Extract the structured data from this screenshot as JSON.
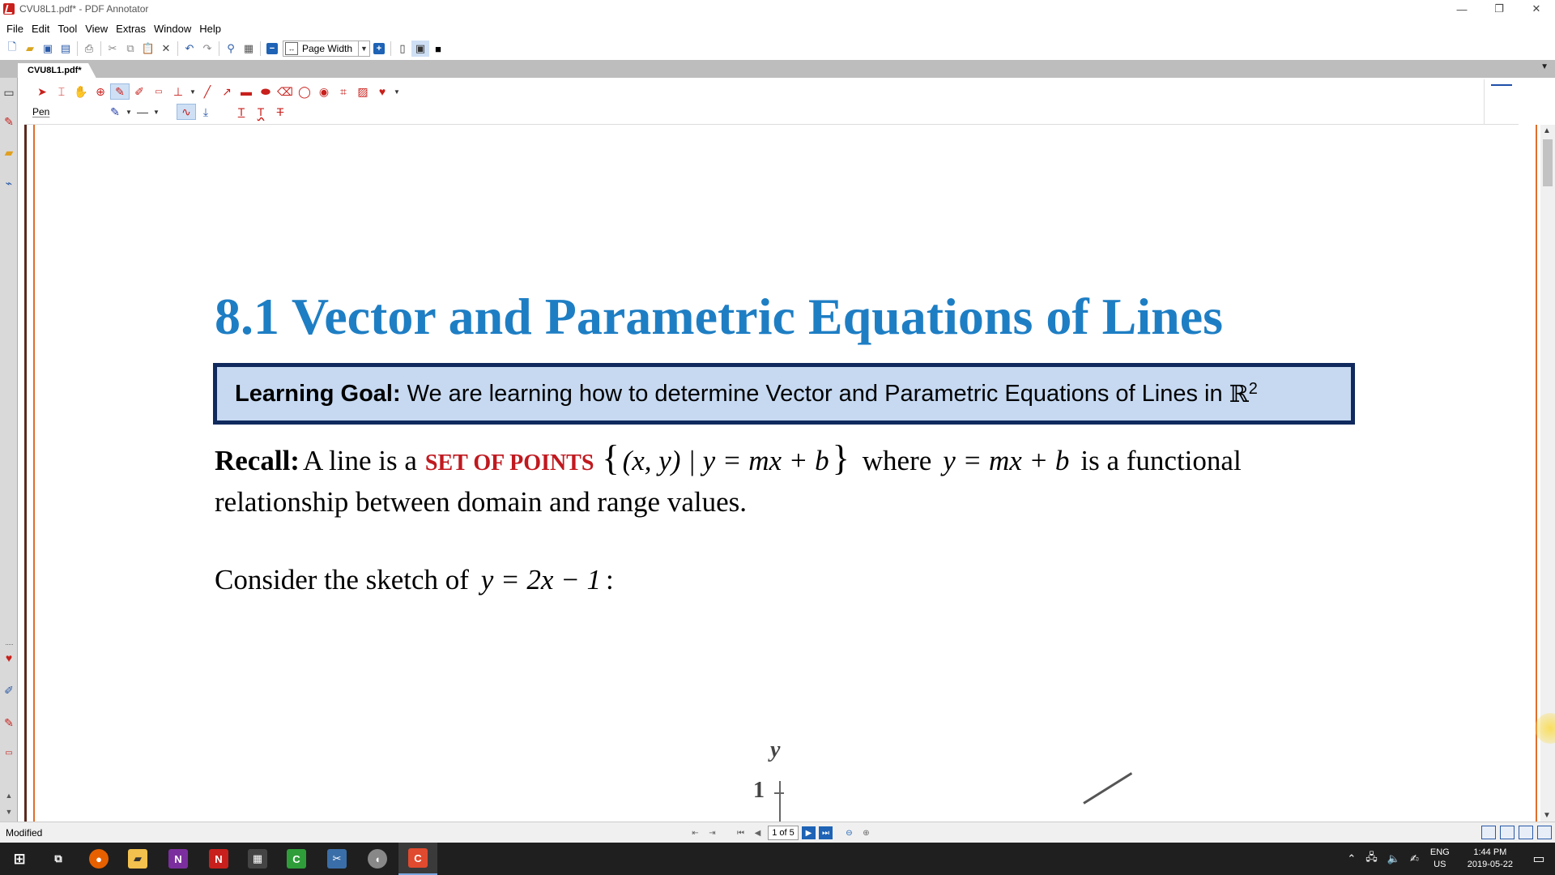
{
  "window": {
    "title": "CVU8L1.pdf* - PDF Annotator",
    "minimize": "—",
    "restore": "❐",
    "close": "✕"
  },
  "menu": [
    "File",
    "Edit",
    "Tool",
    "View",
    "Extras",
    "Window",
    "Help"
  ],
  "toolbar": {
    "zoom_value": "Page Width",
    "zoom_out": "−",
    "zoom_in": "+"
  },
  "tabs": {
    "active": "CVU8L1.pdf*",
    "menu_arrow": "▼"
  },
  "annotation_toolbar": {
    "current_tool": "Pen"
  },
  "document": {
    "title": "8.1 Vector and Parametric Equations of Lines",
    "goal_label": "Learning Goal:",
    "goal_text": "We are learning how to determine Vector and Parametric Equations of Lines in",
    "goal_space": "ℝ",
    "goal_power": "2",
    "recall_label": "Recall",
    "recall_colon": ":",
    "recall_text": "A line is a",
    "set_of_points": "SET OF POINTS",
    "set_notation": "(x, y) | y = mx + b",
    "recall_where": "where",
    "recall_eq": "y = mx + b",
    "recall_tail": "is a functional",
    "recall_line2": "relationship between domain and range values.",
    "consider_text": "Consider the sketch of",
    "consider_eq": "y = 2x − 1",
    "consider_colon": ":",
    "graph_y_label": "y",
    "graph_one_label": "1"
  },
  "status": {
    "text": "Modified",
    "page_indicator": "1 of 5"
  },
  "taskbar": {
    "apps": [
      "start",
      "task-view",
      "firefox",
      "file-explorer",
      "onenote",
      "pdf-annotator",
      "calculator",
      "camtasia-green",
      "snipping",
      "mouse-app",
      "camtasia-recorder"
    ],
    "lang_top": "ENG",
    "lang_bottom": "US",
    "time": "1:44 PM",
    "date": "2019-05-22"
  },
  "colors": {
    "title_blue": "#1e7ec4",
    "goal_fill": "#c6d9f1",
    "goal_border": "#102a5e",
    "set_red": "#c0191f"
  }
}
